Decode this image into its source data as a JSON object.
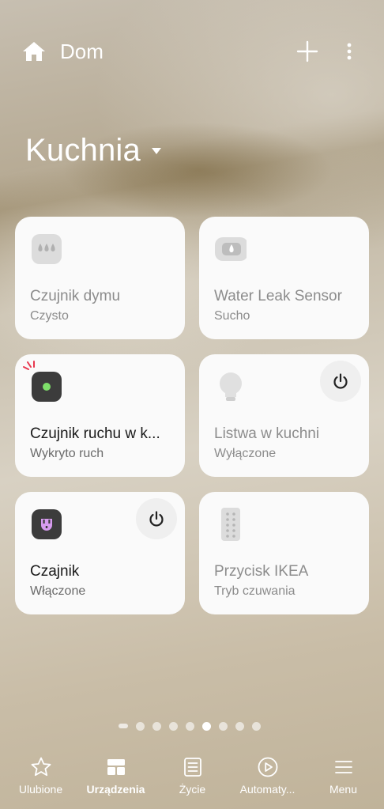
{
  "header": {
    "title": "Dom",
    "add_icon": "plus-icon",
    "more_icon": "vertical-dots-icon"
  },
  "room": {
    "name": "Kuchnia"
  },
  "devices": [
    {
      "name": "Czujnik dymu",
      "status": "Czysto",
      "icon": "smoke-sensor-icon",
      "active": false
    },
    {
      "name": "Water Leak Sensor",
      "status": "Sucho",
      "icon": "water-leak-sensor-icon",
      "active": false
    },
    {
      "name": "Czujnik ruchu w k...",
      "status": "Wykryto ruch",
      "icon": "motion-sensor-icon",
      "active": true
    },
    {
      "name": "Listwa w kuchni",
      "status": "Wyłączone",
      "icon": "bulb-icon",
      "active": false,
      "power_button": true
    },
    {
      "name": "Czajnik",
      "status": "Włączone",
      "icon": "smart-plug-icon",
      "active": true,
      "power_button": true
    },
    {
      "name": "Przycisk IKEA",
      "status": "Tryb czuwania",
      "icon": "remote-icon",
      "active": false
    }
  ],
  "pager": {
    "page_count": 8,
    "current_page": 6
  },
  "nav": [
    {
      "label": "Ulubione",
      "icon": "star-icon",
      "selected": false
    },
    {
      "label": "Urządzenia",
      "icon": "devices-icon",
      "selected": true
    },
    {
      "label": "Życie",
      "icon": "life-icon",
      "selected": false
    },
    {
      "label": "Automaty...",
      "icon": "play-icon",
      "selected": false
    },
    {
      "label": "Menu",
      "icon": "menu-icon",
      "selected": false
    }
  ]
}
